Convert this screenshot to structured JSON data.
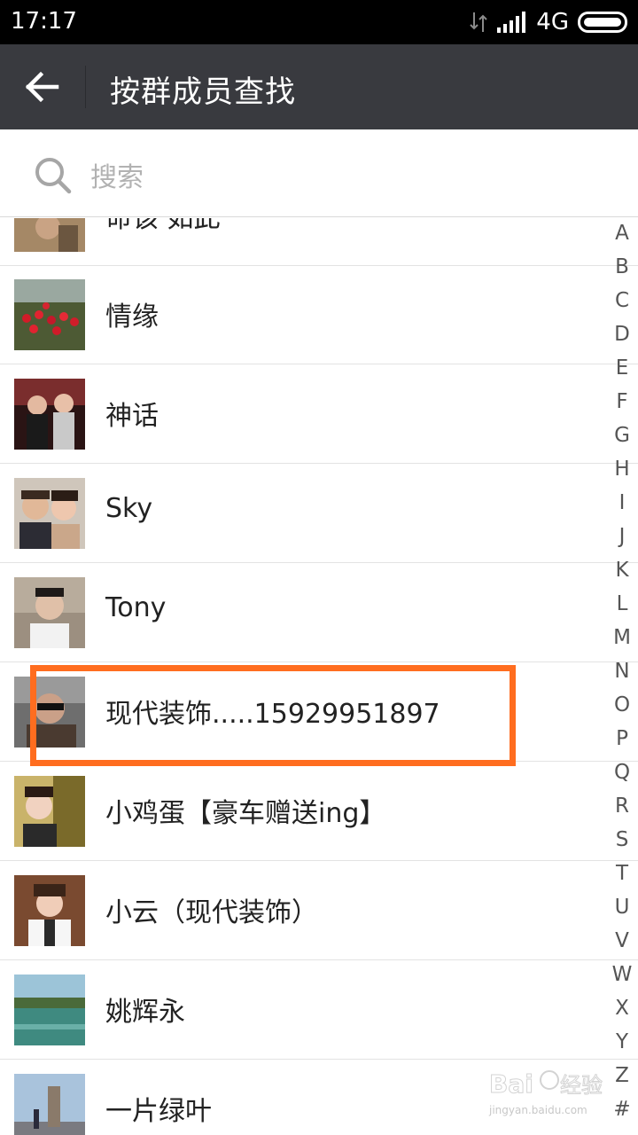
{
  "status_bar": {
    "time": "17:17",
    "network": "4G"
  },
  "header": {
    "title": "按群成员查找"
  },
  "search": {
    "placeholder": "搜索"
  },
  "members": [
    {
      "name": "命该 如此"
    },
    {
      "name": "情缘"
    },
    {
      "name": "神话"
    },
    {
      "name": "Sky"
    },
    {
      "name": "Tony"
    },
    {
      "name": "现代装饰.....15929951897"
    },
    {
      "name": "小鸡蛋【豪车赠送ing】"
    },
    {
      "name": "小云（现代装饰）"
    },
    {
      "name": "姚辉永"
    },
    {
      "name": "一片绿叶"
    }
  ],
  "index_letters": [
    "A",
    "B",
    "C",
    "D",
    "E",
    "F",
    "G",
    "H",
    "I",
    "J",
    "K",
    "L",
    "M",
    "N",
    "O",
    "P",
    "Q",
    "R",
    "S",
    "T",
    "U",
    "V",
    "W",
    "X",
    "Y",
    "Z",
    "#"
  ],
  "watermark": {
    "brand": "Baidu经验",
    "url": "jingyan.baidu.com"
  },
  "colors": {
    "title_bar": "#393a3f",
    "highlight": "#ff6d1f"
  }
}
